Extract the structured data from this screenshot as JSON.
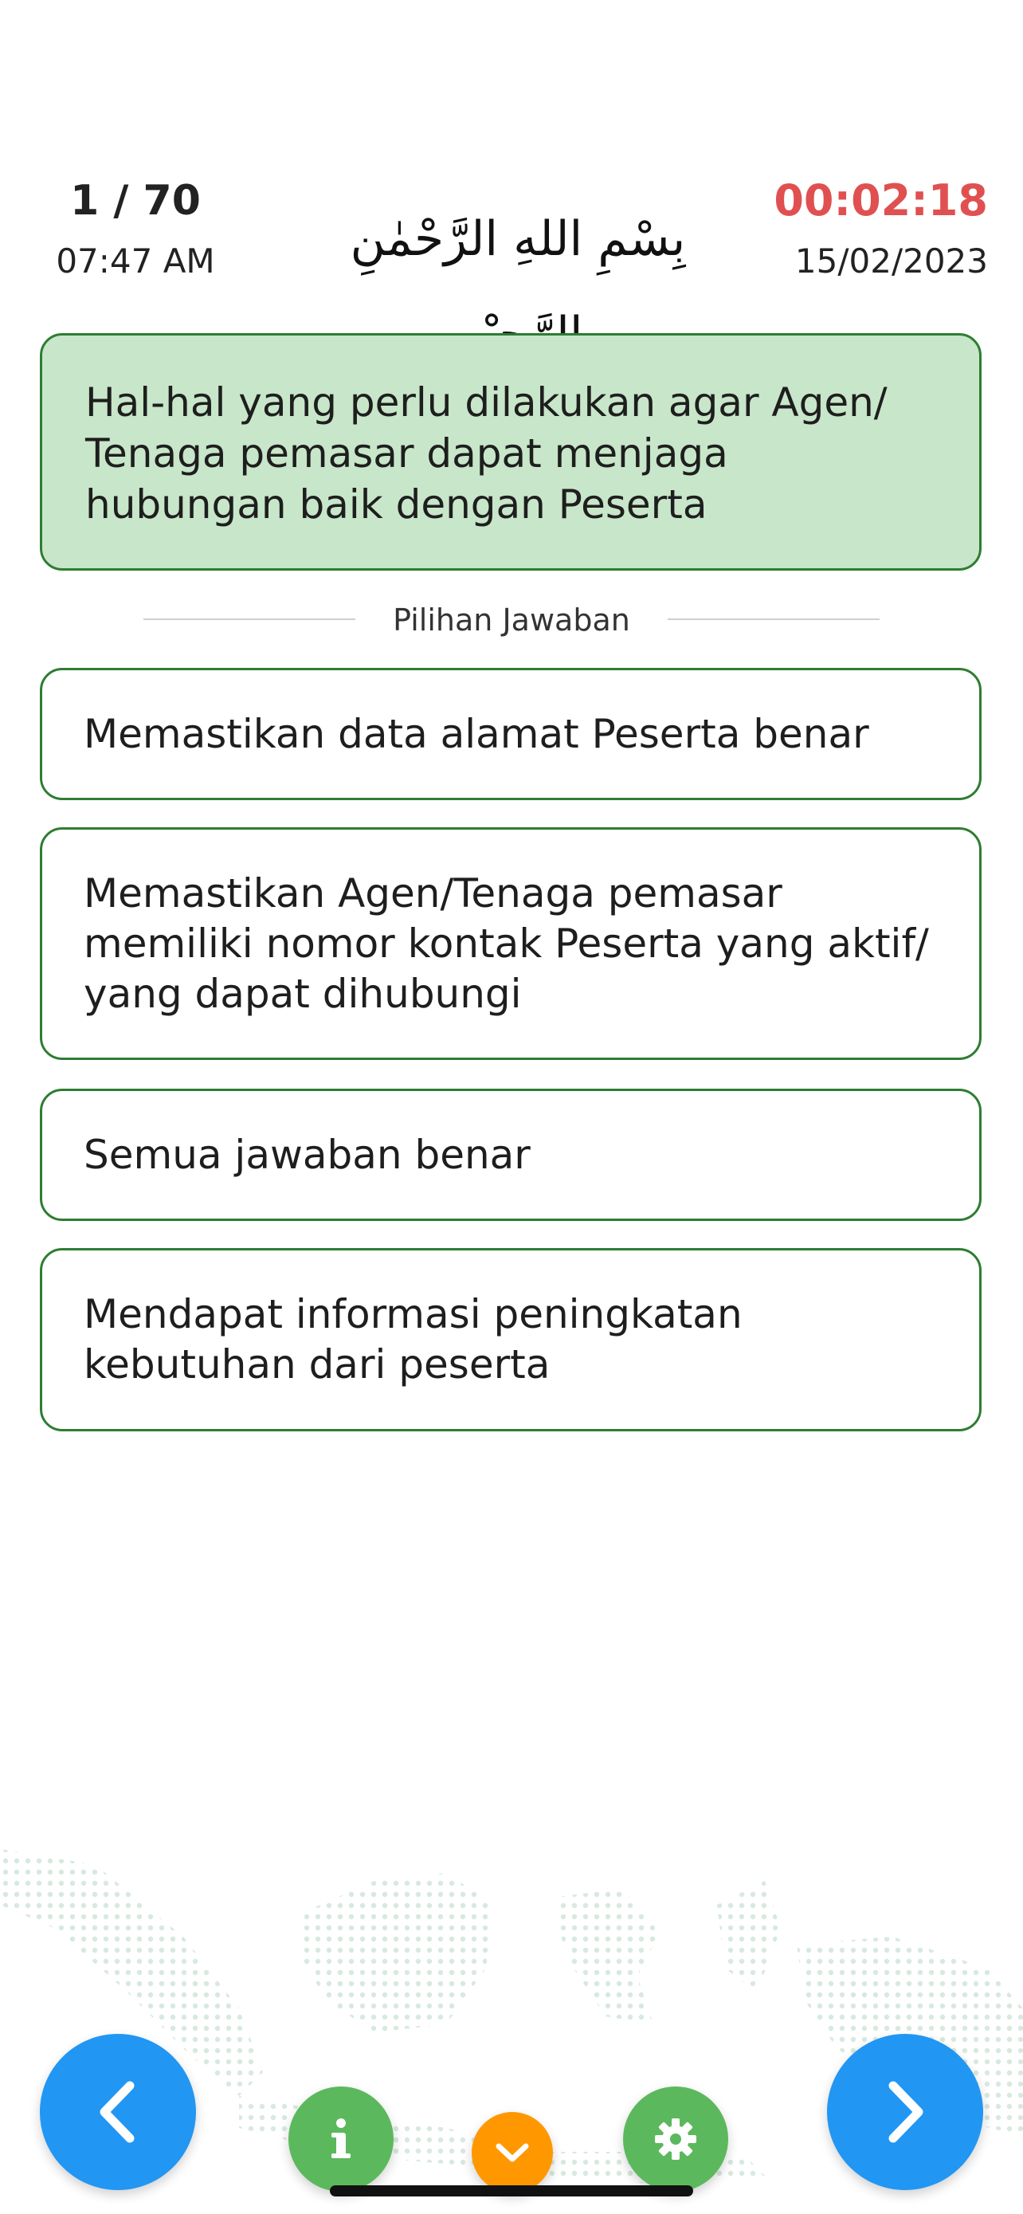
{
  "header": {
    "question_counter": "1 / 70",
    "clock_time": "07:47 AM",
    "basmalah": "بِسْمِ اللهِ الرَّحْمٰنِ الرَّحِيْمِ",
    "countdown_timer": "00:02:18",
    "date": "15/02/2023"
  },
  "question": {
    "text": "Hal-hal yang perlu dilakukan agar Agen/ Tenaga pemasar dapat menjaga hubungan baik dengan Peserta"
  },
  "answers_section": {
    "label": "Pilihan Jawaban",
    "options": [
      "Memastikan data alamat Peserta benar",
      "Memastikan Agen/Tenaga pemasar memiliki nomor kontak Peserta yang aktif/ yang dapat dihubungi",
      "Semua jawaban benar",
      "Mendapat informasi peningkatan kebutuhan dari peserta"
    ]
  },
  "footer": {
    "icons": [
      "chevron-left-icon",
      "info-icon",
      "chevron-down-icon",
      "gear-icon",
      "chevron-right-icon"
    ]
  },
  "colors": {
    "question_bg": "#c8e6c9",
    "border_green": "#2e7d32",
    "timer_red": "#e05050",
    "nav_blue": "#2196f3",
    "action_green": "#5cb85c",
    "collapse_orange": "#ff9800"
  }
}
